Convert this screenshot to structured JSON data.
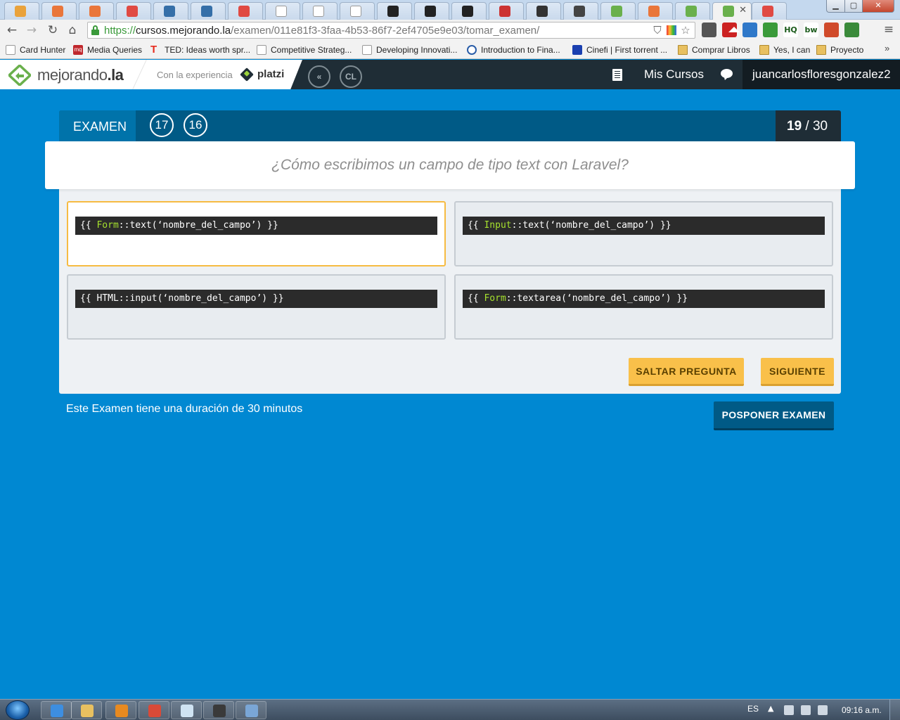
{
  "browser": {
    "tabs": [
      {
        "icon": "pma-icon",
        "color": "#e9a23b"
      },
      {
        "icon": "x-icon",
        "color": "#e9763b"
      },
      {
        "icon": "x-icon",
        "color": "#e9763b"
      },
      {
        "icon": "laravel-icon",
        "color": "#e04a43"
      },
      {
        "icon": "cl-icon",
        "color": "#356fa8"
      },
      {
        "icon": "cl-icon",
        "color": "#356fa8"
      },
      {
        "icon": "laravel-icon",
        "color": "#e04a43"
      },
      {
        "icon": "page-icon",
        "color": "#ffffff"
      },
      {
        "icon": "page-icon",
        "color": "#ffffff"
      },
      {
        "icon": "page-icon",
        "color": "#ffffff"
      },
      {
        "icon": "github-icon",
        "color": "#222222"
      },
      {
        "icon": "github-icon",
        "color": "#222222"
      },
      {
        "icon": "github-icon",
        "color": "#222222"
      },
      {
        "icon": "ruby-icon",
        "color": "#cc3333"
      },
      {
        "icon": "chrome-app-icon",
        "color": "#333333"
      },
      {
        "icon": "square-icon",
        "color": "#444444"
      },
      {
        "icon": "mejorando-icon",
        "color": "#6ab04c"
      },
      {
        "icon": "x-icon",
        "color": "#e9763b"
      },
      {
        "icon": "mejorando-icon",
        "color": "#6ab04c"
      },
      {
        "icon": "mejorando-icon",
        "color": "#6ab04c",
        "active": true
      },
      {
        "icon": "laravel-icon",
        "color": "#e04a43"
      }
    ],
    "url": {
      "scheme": "https://",
      "host": "cursos.mejorando.la",
      "path": "/examen/011e81f3-3faa-4b53-86f7-2ef4705e9e03/tomar_examen/"
    },
    "extensions": [
      {
        "icon": "eyedropper-icon",
        "color": "#555555",
        "text": ""
      },
      {
        "icon": "stop-icon",
        "color": "#cc2222",
        "text": ""
      },
      {
        "icon": "calendar-icon",
        "color": "#2f78c9",
        "text": ""
      },
      {
        "icon": "color-grid-icon",
        "color": "#3a9a3a",
        "text": ""
      },
      {
        "icon": "cloud-hq-icon",
        "color": "#ffffff",
        "text": "HQ"
      },
      {
        "icon": "bw-icon",
        "color": "#ffffff",
        "text": "bw"
      },
      {
        "icon": "office-icon",
        "color": "#d04a2a",
        "text": ""
      },
      {
        "icon": "spreadsheet-icon",
        "color": "#3a8a3a",
        "text": ""
      }
    ],
    "bookmarks": [
      {
        "label": "Card Hunter",
        "icon": "page"
      },
      {
        "label": "Media Queries",
        "icon": "mq"
      },
      {
        "label": "TED: Ideas worth spr...",
        "icon": "ted"
      },
      {
        "label": "Competitive Strateg...",
        "icon": "page"
      },
      {
        "label": "Developing Innovati...",
        "icon": "page"
      },
      {
        "label": "Introduction to Fina...",
        "icon": "coursera"
      },
      {
        "label": "Cinefi | First torrent ...",
        "icon": "cinefi"
      },
      {
        "label": "Comprar Libros",
        "icon": "folder"
      },
      {
        "label": "Yes, I can",
        "icon": "folder"
      },
      {
        "label": "Proyecto",
        "icon": "folder"
      }
    ],
    "more_bookmarks": "»"
  },
  "site": {
    "logo_main": "mejorando",
    "logo_tld": ".la",
    "partner_label": "Con la experiencia",
    "partner_name": "platzi",
    "circle_logos": [
      "«",
      "CL"
    ],
    "nav_link": "Mis Cursos",
    "username": "juancarlosfloresgonzalez2"
  },
  "exam": {
    "label": "EXAMEN",
    "counters": [
      "17",
      "16"
    ],
    "progress_current": "19",
    "progress_total": " / 30",
    "question": "¿Cómo escribimos un campo de tipo text con Laravel?",
    "options": [
      {
        "prefix": "{{ ",
        "class": "Form",
        "rest": "::text(‘nombre_del_campo’) }}",
        "selected": true
      },
      {
        "prefix": "{{ ",
        "class": "Input",
        "rest": "::text(‘nombre_del_campo’) }}",
        "selected": false
      },
      {
        "prefix": "{{ HTML::input(‘nombre_del_campo’) }}",
        "class": "",
        "rest": "",
        "selected": false
      },
      {
        "prefix": "{{ ",
        "class": "Form",
        "rest": "::textarea(‘nombre_del_campo’) }}",
        "selected": false
      }
    ],
    "skip_label": "SALTAR PREGUNTA",
    "next_label": "SIGUIENTE",
    "duration_text": "Este Examen tiene una duración de 30 minutos",
    "postpone_label": "POSPONER EXAMEN"
  },
  "taskbar": {
    "apps": [
      {
        "icon": "ie-icon",
        "color": "#3d8ee0"
      },
      {
        "icon": "explorer-icon",
        "color": "#e8c060"
      },
      {
        "icon": "media-player-icon",
        "color": "#e88a20"
      },
      {
        "icon": "chrome-icon",
        "color": "#d94a38"
      },
      {
        "icon": "notepad-icon",
        "color": "#cfe3f2"
      },
      {
        "icon": "terminal-icon",
        "color": "#3a3a3a"
      },
      {
        "icon": "paint-icon",
        "color": "#7aa6d6"
      }
    ],
    "language": "ES",
    "tray_up": "▲",
    "clock": "09:16 a.m."
  }
}
